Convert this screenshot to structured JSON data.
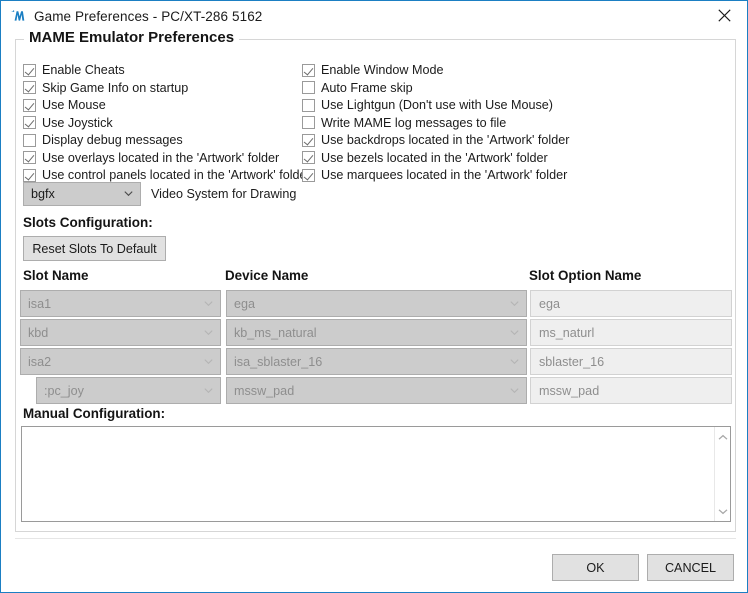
{
  "window": {
    "title": "Game Preferences - PC/XT-286 5162",
    "icon": "mame-logo-icon",
    "close_icon": "close-icon",
    "border_color": "#1b7fc3"
  },
  "groupbox": {
    "title": "MAME Emulator Preferences"
  },
  "checkboxes": {
    "left": [
      {
        "label": "Enable Cheats",
        "checked": true
      },
      {
        "label": "Skip Game Info on startup",
        "checked": true
      },
      {
        "label": "Use Mouse",
        "checked": true
      },
      {
        "label": "Use Joystick",
        "checked": true
      },
      {
        "label": "Display debug messages",
        "checked": false
      },
      {
        "label": "Use overlays located in the 'Artwork' folder",
        "checked": true
      },
      {
        "label": "Use control panels located in the 'Artwork' folder",
        "checked": true
      }
    ],
    "right": [
      {
        "label": "Enable Window Mode",
        "checked": true
      },
      {
        "label": "Auto Frame skip",
        "checked": false
      },
      {
        "label": "Use Lightgun (Don't use with Use Mouse)",
        "checked": false
      },
      {
        "label": "Write MAME log messages to file",
        "checked": false
      },
      {
        "label": "Use backdrops located in the 'Artwork' folder",
        "checked": true
      },
      {
        "label": "Use bezels located in the 'Artwork' folder",
        "checked": true
      },
      {
        "label": "Use marquees located in the 'Artwork' folder",
        "checked": true
      }
    ]
  },
  "video_system": {
    "value": "bgfx",
    "label": "Video System for Drawing",
    "options": [
      "bgfx"
    ]
  },
  "slots": {
    "heading": "Slots Configuration:",
    "reset_label": "Reset Slots To Default",
    "headers": {
      "slot_name": "Slot Name",
      "device_name": "Device Name",
      "slot_option_name": "Slot Option Name"
    },
    "rows": [
      {
        "slot": "isa1",
        "device": "ega",
        "option": "ega",
        "indent": false
      },
      {
        "slot": "kbd",
        "device": "kb_ms_natural",
        "option": "ms_naturl",
        "indent": false
      },
      {
        "slot": "isa2",
        "device": "isa_sblaster_16",
        "option": "sblaster_16",
        "indent": false
      },
      {
        "slot": ":pc_joy",
        "device": "mssw_pad",
        "option": "mssw_pad",
        "indent": true
      }
    ]
  },
  "manual": {
    "heading": "Manual Configuration:",
    "value": "",
    "placeholder": ""
  },
  "footer": {
    "ok_label": "OK",
    "cancel_label": "CANCEL"
  }
}
